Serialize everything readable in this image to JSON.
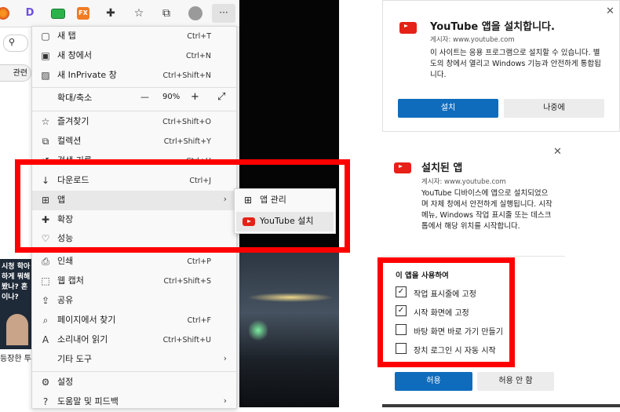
{
  "browser": {
    "toolbar_icons": [
      "extension-icon-orange",
      "d-extension-icon",
      "green-extension-icon",
      "fx-extension-icon",
      "puzzle-icon",
      "favorites-icon",
      "collections-icon",
      "profile-icon",
      "more-icon"
    ],
    "fx_label": "FX",
    "d_label": "D",
    "more_label": "···",
    "tag_chip": "관련",
    "thumb_text": "시청 학아 하게 뭐해 봤나? 혼이나?",
    "thumb_caption": "등장한 투"
  },
  "menu": {
    "items": [
      {
        "icon": "new-tab-icon",
        "label": "새 탭",
        "shortcut": "Ctrl+T"
      },
      {
        "icon": "new-window-icon",
        "label": "새 창에서",
        "shortcut": "Ctrl+N"
      },
      {
        "icon": "inprivate-icon",
        "label": "새 InPrivate 창",
        "shortcut": "Ctrl+Shift+N"
      },
      {
        "label": "확대/축소",
        "zoom_minus": "—",
        "zoom_value": "90%",
        "zoom_plus": "+",
        "fullscreen": "⤢"
      },
      {
        "icon": "favorites-icon",
        "label": "즐겨찾기",
        "shortcut": "Ctrl+Shift+O"
      },
      {
        "icon": "collections-icon",
        "label": "컬렉션",
        "shortcut": "Ctrl+Shift+Y"
      },
      {
        "icon": "history-icon",
        "label": "검색 기록",
        "shortcut": "Ctrl+H"
      },
      {
        "icon": "download-icon",
        "label": "다운로드",
        "shortcut": "Ctrl+J"
      },
      {
        "icon": "apps-icon",
        "label": "앱",
        "arrow": "›"
      },
      {
        "icon": "extensions-icon",
        "label": "확장"
      },
      {
        "icon": "performance-icon",
        "label": "성능"
      },
      {
        "icon": "print-icon",
        "label": "인쇄",
        "shortcut": "Ctrl+P"
      },
      {
        "icon": "web-capture-icon",
        "label": "웹 캡처",
        "shortcut": "Ctrl+Shift+S"
      },
      {
        "icon": "share-icon",
        "label": "공유"
      },
      {
        "icon": "find-icon",
        "label": "페이지에서 찾기",
        "shortcut": "Ctrl+F"
      },
      {
        "icon": "read-aloud-icon",
        "label": "소리내어 읽기",
        "shortcut": "Ctrl+Shift+U"
      },
      {
        "label": "기타 도구",
        "arrow": "›"
      },
      {
        "icon": "settings-icon",
        "label": "설정"
      },
      {
        "icon": "help-icon",
        "label": "도움말 및 피드백",
        "arrow": "›"
      }
    ]
  },
  "submenu": {
    "items": [
      {
        "icon": "apps-manage-icon",
        "label": "앱 관리"
      },
      {
        "icon": "youtube-icon",
        "label": "YouTube 설치"
      }
    ]
  },
  "install_dialog": {
    "title": "YouTube 앱을 설치합니다.",
    "publisher": "게시자: www.youtube.com",
    "body": "이 사이트는 응용 프로그램으로 설치할 수 있습니다. 별도의 창에서 열리고 Windows 기능과 안전하게 통합됩니다.",
    "install_button": "설치",
    "later_button": "나중에",
    "close": "✕"
  },
  "installed_dialog": {
    "title": "설치된 앱",
    "publisher": "게시자: www.youtube.com",
    "body": "YouTube 디바이스에 앱으로 설치되었으며 자체 창에서 안전하게 실행됩니다. 시작 메뉴, Windows 작업 표시줄 또는 데스크톱에서 해당 위치를 시작합니다.",
    "section_title": "이 앱을 사용하여",
    "options": [
      {
        "label": "작업 표시줄에 고정",
        "checked": true
      },
      {
        "label": "시작 화면에 고정",
        "checked": true
      },
      {
        "label": "바탕 화면 바로 가기 만들기",
        "checked": false
      },
      {
        "label": "장치 로그인 시 자동 시작",
        "checked": false
      }
    ],
    "allow_button": "허용",
    "deny_button": "허용 안 함",
    "close": "✕",
    "check_mark": "✓"
  },
  "colors": {
    "highlight": "#ff0000",
    "accent": "#0f6cbd",
    "youtube": "#e62117"
  }
}
